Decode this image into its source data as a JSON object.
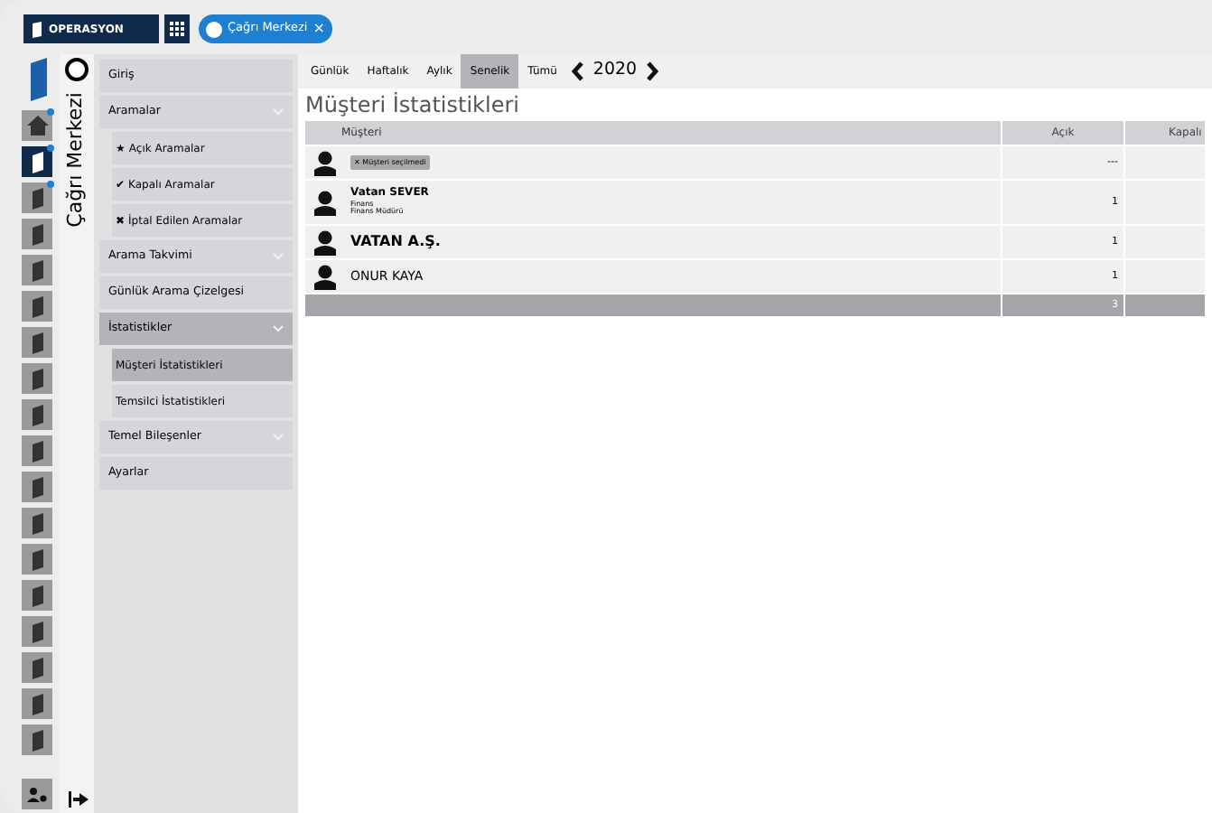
{
  "topbar": {
    "module": "OPERASYON",
    "tab": {
      "label": "Çağrı Merkezi",
      "close": "×"
    }
  },
  "rail": [
    {
      "selected": false,
      "badge": true
    },
    {
      "selected": true,
      "badge": true
    },
    {
      "selected": false,
      "badge": true
    },
    {
      "selected": false,
      "badge": false
    },
    {
      "selected": false,
      "badge": false
    },
    {
      "selected": false,
      "badge": false
    },
    {
      "selected": false,
      "badge": false
    },
    {
      "selected": false,
      "badge": false
    },
    {
      "selected": false,
      "badge": false
    },
    {
      "selected": false,
      "badge": false
    },
    {
      "selected": false,
      "badge": false
    },
    {
      "selected": false,
      "badge": false
    },
    {
      "selected": false,
      "badge": false
    },
    {
      "selected": false,
      "badge": false
    },
    {
      "selected": false,
      "badge": false
    },
    {
      "selected": false,
      "badge": false
    },
    {
      "selected": false,
      "badge": false
    },
    {
      "selected": false,
      "badge": false
    }
  ],
  "section_title": "Çağrı Merkezi",
  "menu": [
    {
      "kind": "item",
      "label": "Giriş",
      "expandable": false,
      "selected": false
    },
    {
      "kind": "item",
      "label": "Aramalar",
      "expandable": true,
      "selected": false
    },
    {
      "kind": "sub",
      "glyph": "★",
      "label": "Açık Aramalar",
      "selected": false
    },
    {
      "kind": "sub",
      "glyph": "✔",
      "label": "Kapalı Aramalar",
      "selected": false
    },
    {
      "kind": "sub",
      "glyph": "✖",
      "label": "İptal Edilen Aramalar",
      "selected": false
    },
    {
      "kind": "item",
      "label": "Arama Takvimi",
      "expandable": true,
      "selected": false
    },
    {
      "kind": "item",
      "label": "Günlük Arama Çizelgesi",
      "expandable": false,
      "selected": false
    },
    {
      "kind": "item",
      "label": "İstatistikler",
      "expandable": true,
      "selected": true
    },
    {
      "kind": "sub",
      "label": "Müşteri İstatistikleri",
      "selected": true
    },
    {
      "kind": "sub",
      "label": "Temsilci İstatistikleri",
      "selected": false
    },
    {
      "kind": "item",
      "label": "Temel Bileşenler",
      "expandable": true,
      "selected": false
    },
    {
      "kind": "item",
      "label": "Ayarlar",
      "expandable": false,
      "selected": false
    }
  ],
  "periods": [
    {
      "label": "Günlük",
      "selected": false
    },
    {
      "label": "Haftalık",
      "selected": false
    },
    {
      "label": "Aylık",
      "selected": false
    },
    {
      "label": "Senelik",
      "selected": true
    },
    {
      "label": "Tümü",
      "selected": false
    }
  ],
  "year": "2020",
  "title": "Müşteri İstatistikleri",
  "table": {
    "columns": [
      "Müşteri",
      "Açık",
      "Kapalı"
    ],
    "rows": [
      {
        "kind": "filter",
        "tag": "✕ Müşteri seçilmedi",
        "open": "---"
      },
      {
        "kind": "detail",
        "name": "Vatan SEVER",
        "lines": [
          "Finans",
          "Finans Müdürü"
        ],
        "open": "1"
      },
      {
        "kind": "large",
        "name": "VATAN A.Ş.",
        "open": "1"
      },
      {
        "kind": "plain",
        "name": "ONUR KAYA",
        "open": "1"
      }
    ],
    "total": "3"
  }
}
